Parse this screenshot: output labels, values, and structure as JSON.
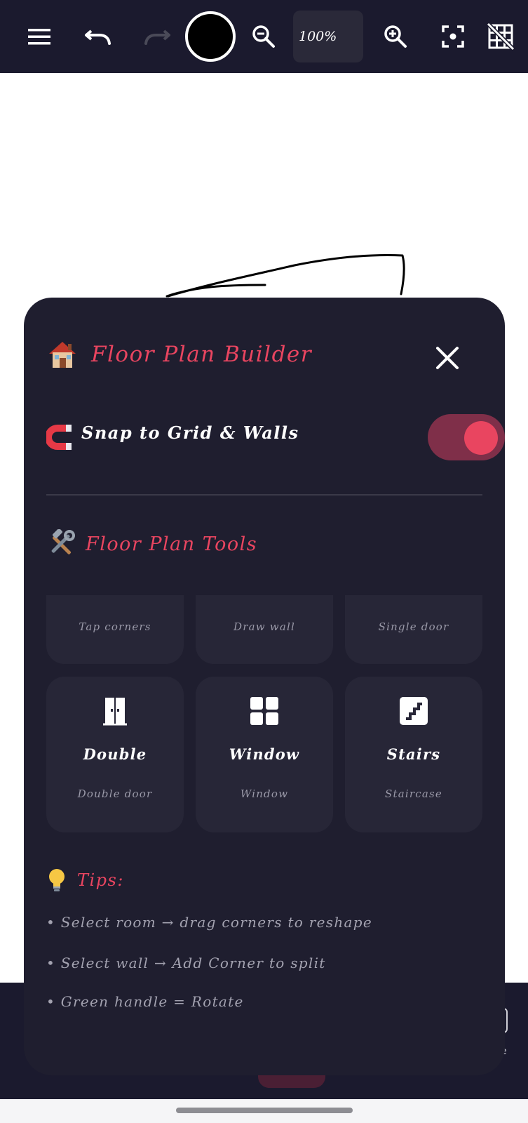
{
  "toolbar": {
    "zoom_level": "100%",
    "icons": [
      "menu-icon",
      "undo-icon",
      "redo-icon",
      "zoom-out-icon",
      "zoom-in-icon",
      "fit-screen-icon",
      "grid-off-icon"
    ],
    "current_color": "#000000",
    "redo_enabled": false
  },
  "panel": {
    "title": "Floor Plan Builder",
    "snap": {
      "label": "Snap to Grid & Walls",
      "enabled": true
    },
    "tools_heading": "Floor Plan Tools",
    "tools_partial": [
      {
        "desc": "Tap corners"
      },
      {
        "desc": "Draw wall"
      },
      {
        "desc": "Single door"
      }
    ],
    "tools": [
      {
        "label": "Double",
        "desc": "Double door",
        "icon": "double-door-icon"
      },
      {
        "label": "Window",
        "desc": "Window",
        "icon": "window-icon"
      },
      {
        "label": "Stairs",
        "desc": "Staircase",
        "icon": "stairs-icon"
      }
    ],
    "tips_heading": "Tips:",
    "tips": [
      "• Select room → drag corners to reshape",
      "• Select wall → Add Corner to split",
      "• Green handle = Rotate"
    ]
  },
  "bottom_bar": {
    "partial_label": "e"
  },
  "colors": {
    "accent": "#e94560",
    "panel_bg": "#1f1e2f",
    "toolbar_bg": "#1b1a2e",
    "card_bg": "#272637",
    "toggle_track": "#7f2f49"
  }
}
